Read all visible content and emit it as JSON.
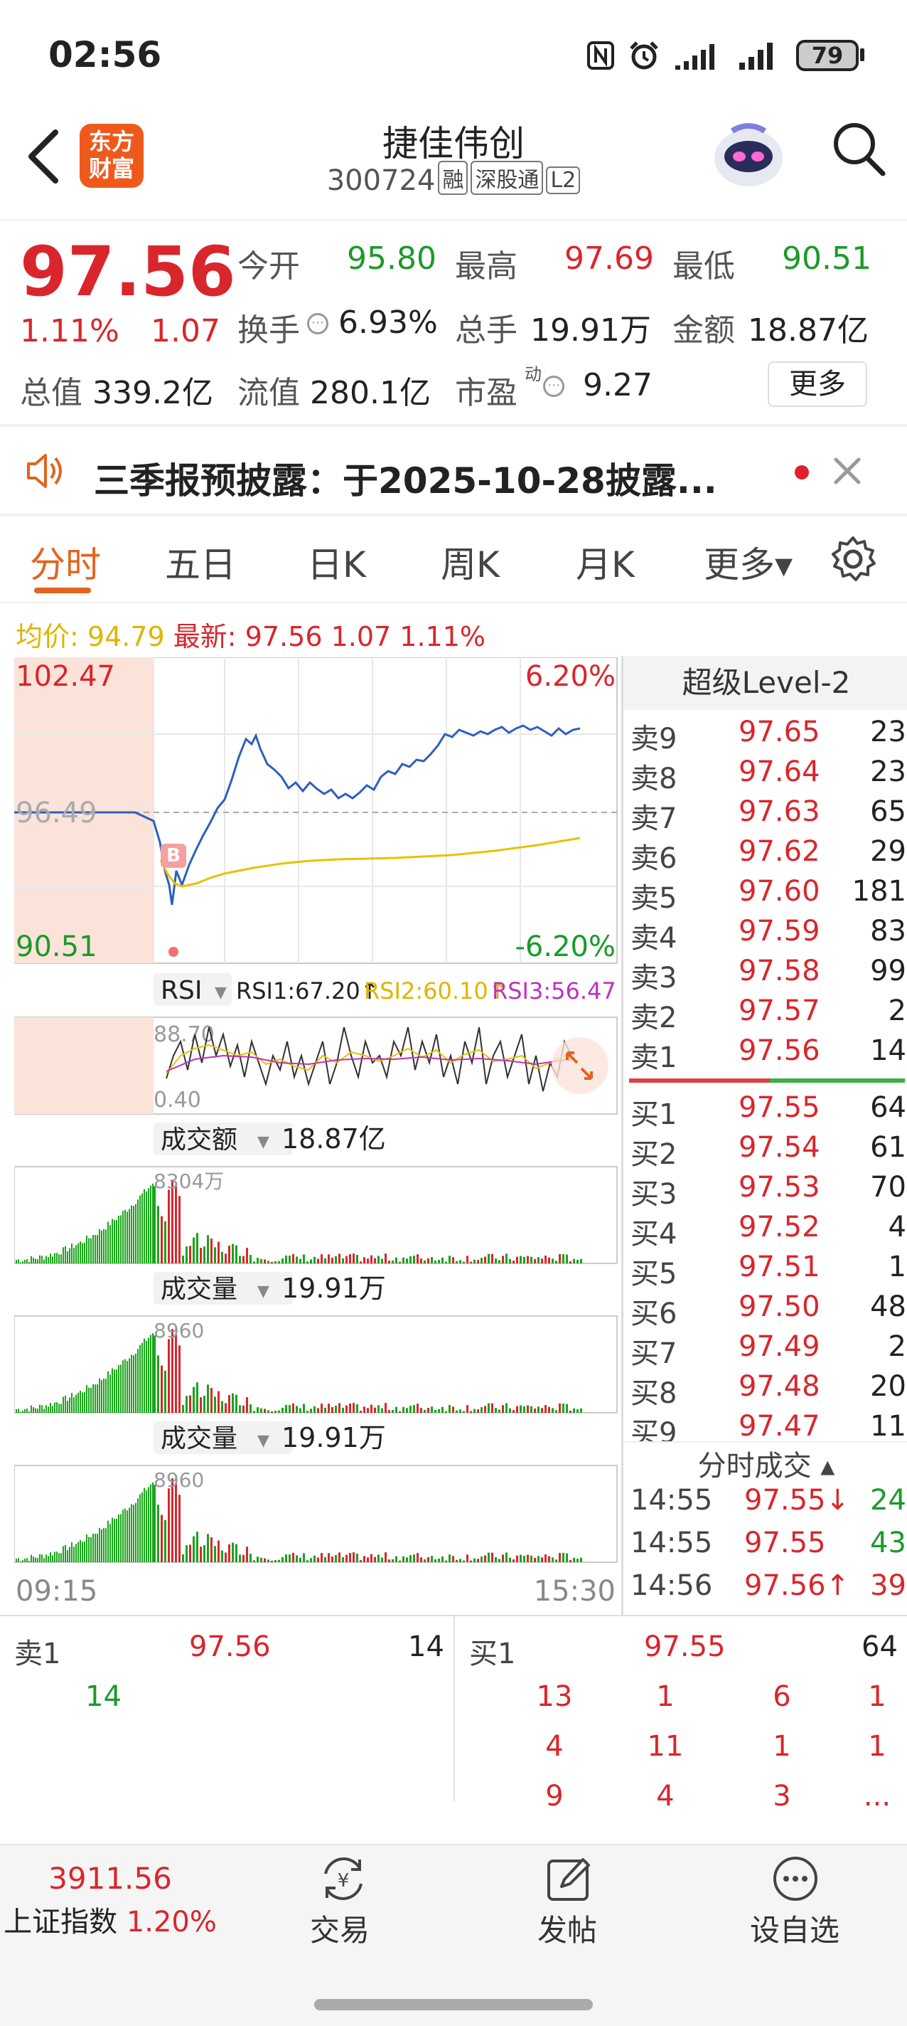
{
  "status_bar": {
    "time": "02:56",
    "battery": "79"
  },
  "header": {
    "title": "捷佳伟创",
    "code": "300724",
    "tags": [
      "融",
      "深股通",
      "L2"
    ],
    "app_logo": "东方\n财富"
  },
  "quote": {
    "price": "97.56",
    "change_pct": "1.11%",
    "change": "1.07",
    "fields": [
      {
        "label": "今开",
        "value": "95.80",
        "color": "green"
      },
      {
        "label": "最高",
        "value": "97.69",
        "color": "red"
      },
      {
        "label": "最低",
        "value": "90.51",
        "color": "green"
      },
      {
        "label": "换手",
        "value": "6.93%",
        "color": "dark"
      },
      {
        "label": "总手",
        "value": "19.91万",
        "color": "dark"
      },
      {
        "label": "金额",
        "value": "18.87亿",
        "color": "dark"
      },
      {
        "label": "总值",
        "value": "339.2亿",
        "color": "dark"
      },
      {
        "label": "流值",
        "value": "280.1亿",
        "color": "dark"
      },
      {
        "label": "市盈",
        "value": "9.27",
        "color": "dark",
        "superscript": "动"
      }
    ],
    "more_button": "更多"
  },
  "notice": {
    "text": "三季报预披露：于2025-10-28披露..."
  },
  "tabs": [
    "分时",
    "五日",
    "日K",
    "周K",
    "月K",
    "更多▾"
  ],
  "active_tab": "分时",
  "avg_line": {
    "avg_label": "均价:",
    "avg_value": "94.79",
    "latest_label": "最新:",
    "latest_value": "97.56",
    "latest_change": "1.07",
    "latest_pct": "1.11%"
  },
  "price_chart": {
    "y_high": "102.47",
    "y_mid": "96.49",
    "y_low": "90.51",
    "pct_high": "6.20%",
    "pct_low": "-6.20%",
    "marker": "B",
    "time_start": "09:15",
    "time_end": "15:30"
  },
  "rsi": {
    "name": "RSI",
    "rsi1": "RSI1:67.20↑",
    "rsi2": "RSI2:60.10↑",
    "rsi3": "RSI3:56.47↑",
    "y_high": "88.70",
    "y_low": "0.40"
  },
  "turnover": {
    "name": "成交额",
    "value": "18.87亿",
    "peak": "8304万"
  },
  "volume1": {
    "name": "成交量",
    "value": "19.91万",
    "peak": "8960"
  },
  "volume2": {
    "name": "成交量",
    "value": "19.91万",
    "peak": "8960"
  },
  "level2": {
    "title": "超级Level-2",
    "asks": [
      {
        "name": "卖9",
        "price": "97.65",
        "vol": "23"
      },
      {
        "name": "卖8",
        "price": "97.64",
        "vol": "23"
      },
      {
        "name": "卖7",
        "price": "97.63",
        "vol": "65"
      },
      {
        "name": "卖6",
        "price": "97.62",
        "vol": "29"
      },
      {
        "name": "卖5",
        "price": "97.60",
        "vol": "181"
      },
      {
        "name": "卖4",
        "price": "97.59",
        "vol": "83"
      },
      {
        "name": "卖3",
        "price": "97.58",
        "vol": "99"
      },
      {
        "name": "卖2",
        "price": "97.57",
        "vol": "2"
      },
      {
        "name": "卖1",
        "price": "97.56",
        "vol": "14"
      }
    ],
    "bids": [
      {
        "name": "买1",
        "price": "97.55",
        "vol": "64"
      },
      {
        "name": "买2",
        "price": "97.54",
        "vol": "61"
      },
      {
        "name": "买3",
        "price": "97.53",
        "vol": "70"
      },
      {
        "name": "买4",
        "price": "97.52",
        "vol": "4"
      },
      {
        "name": "买5",
        "price": "97.51",
        "vol": "1"
      },
      {
        "name": "买6",
        "price": "97.50",
        "vol": "48"
      },
      {
        "name": "买7",
        "price": "97.49",
        "vol": "2"
      },
      {
        "name": "买8",
        "price": "97.48",
        "vol": "20"
      },
      {
        "name": "买9",
        "price": "97.47",
        "vol": "11"
      }
    ],
    "ticks_title": "分时成交 ▴",
    "ticks": [
      {
        "time": "14:55",
        "price": "97.55↓",
        "vol": "24",
        "vol_color": "green"
      },
      {
        "time": "14:55",
        "price": "97.55",
        "vol": "43",
        "vol_color": "green"
      },
      {
        "time": "14:56",
        "price": "97.56↑",
        "vol": "39",
        "vol_color": "red"
      }
    ]
  },
  "queue": {
    "sell_label": "卖1",
    "sell_price": "97.56",
    "sell_vol": "14",
    "buy_label": "买1",
    "buy_price": "97.55",
    "buy_vol": "64",
    "sell_orders": [
      "14"
    ],
    "buy_orders": [
      "13",
      "1",
      "6",
      "1",
      "4",
      "11",
      "1",
      "1",
      "9",
      "4",
      "3",
      "..."
    ]
  },
  "bottom_nav": {
    "index_value": "3911.56",
    "index_name": "上证指数",
    "index_pct": "1.20%",
    "items": [
      "交易",
      "发帖",
      "设自选"
    ]
  }
}
